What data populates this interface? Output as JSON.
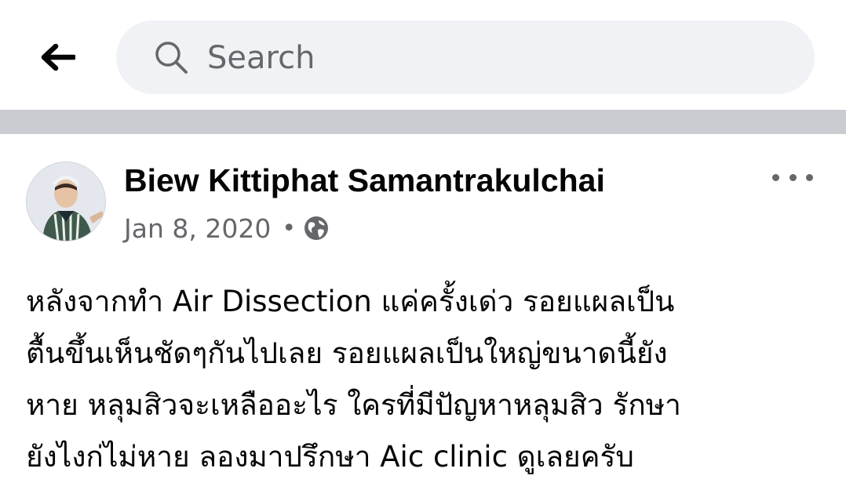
{
  "header": {
    "back_icon": "arrow-left-icon",
    "search": {
      "placeholder": "Search",
      "value": "",
      "icon": "search-icon"
    }
  },
  "post": {
    "author": "Biew Kittiphat Samantrakulchai",
    "date": "Jan 8, 2020",
    "separator": "•",
    "privacy_icon": "globe-icon",
    "more_icon": "more-options-icon",
    "text_lines": [
      "หลังจากทำ Air Dissection แค่ครั้งเด่ว รอยแผลเป็น",
      "ตื้นขึ้นเห็นชัดๆกันไปเลย รอยแผลเป็นใหญ่ขนาดนี้ยัง",
      "หาย หลุมสิวจะเหลืออะไร ใครที่มีปัญหาหลุมสิว รักษา",
      "ยังไงก่ไม่หาย ลองมาปรึกษา Aic clinic ดูเลยครับ"
    ]
  },
  "colors": {
    "search_bg": "#f0f2f5",
    "divider": "#c9ccd1",
    "secondary_text": "#65676b",
    "primary_text": "#050505"
  }
}
